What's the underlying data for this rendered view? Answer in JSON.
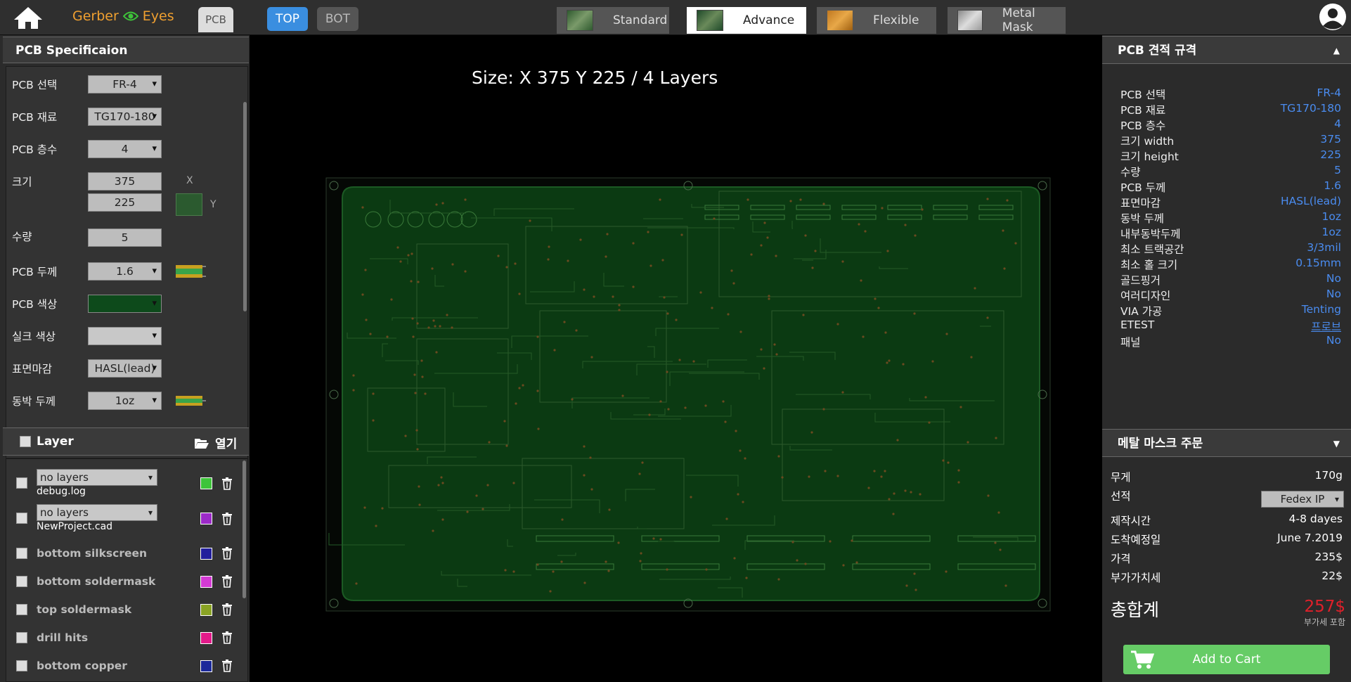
{
  "topbar": {
    "brand_left": "Gerber",
    "brand_right": "Eyes",
    "pcb_tab": "PCB",
    "side_tabs": {
      "top": "TOP",
      "bot": "BOT"
    },
    "product_tabs": [
      {
        "label": "Standard",
        "active": false
      },
      {
        "label": "Advance",
        "active": true
      },
      {
        "label": "Flexible",
        "active": false
      },
      {
        "label": "Metal Mask",
        "active": false
      }
    ]
  },
  "spec_panel": {
    "title": "PCB Specificaion",
    "rows": {
      "pcb_select": {
        "label": "PCB 선택",
        "value": "FR-4"
      },
      "pcb_material": {
        "label": "PCB 재료",
        "value": "TG170-180"
      },
      "pcb_layers": {
        "label": "PCB 층수",
        "value": "4"
      },
      "size": {
        "label": "크기",
        "x": "375",
        "y": "225",
        "x_label": "X",
        "y_label": "Y"
      },
      "quantity": {
        "label": "수량",
        "value": "5"
      },
      "thickness": {
        "label": "PCB 두께",
        "value": "1.6"
      },
      "pcb_color": {
        "label": "PCB 색상",
        "value_color": "#0d4a1b"
      },
      "silk_color": {
        "label": "실크 색상"
      },
      "surface": {
        "label": "표면마감",
        "value": "HASL(lead)"
      },
      "copper": {
        "label": "동박 두께",
        "value": "1oz"
      }
    }
  },
  "layer_panel": {
    "title": "Layer",
    "open_label": "열기",
    "layers": [
      {
        "select": "no layers",
        "name": "debug.log",
        "color": "#3ec43a"
      },
      {
        "select": "no layers",
        "name": "NewProject.cad",
        "color": "#9c2ac8"
      },
      {
        "name": "bottom silkscreen",
        "color": "#221e9c"
      },
      {
        "name": "bottom soldermask",
        "color": "#d43ad4"
      },
      {
        "name": "top soldermask",
        "color": "#8aa324"
      },
      {
        "name": "drill hits",
        "color": "#e21a8a"
      },
      {
        "name": "bottom copper",
        "color": "#1c2a9a"
      }
    ]
  },
  "viewer": {
    "size_text": "Size: X 375 Y 225 / 4 Layers",
    "board_color": "#0b3a12"
  },
  "quote_panel": {
    "title": "PCB 견적 규격",
    "rows": [
      {
        "label": "PCB 선택",
        "value": "FR-4"
      },
      {
        "label": "PCB 재료",
        "value": "TG170-180"
      },
      {
        "label": "PCB 층수",
        "value": "4"
      },
      {
        "label": "크기 width",
        "value": "375"
      },
      {
        "label": "크기 height",
        "value": "225"
      },
      {
        "label": "수량",
        "value": "5"
      },
      {
        "label": "PCB 두께",
        "value": "1.6"
      },
      {
        "label": "표면마감",
        "value": "HASL(lead)"
      },
      {
        "label": "동박 두께",
        "value": "1oz"
      },
      {
        "label": "내부동박두께",
        "value": "1oz"
      },
      {
        "label": "최소 트랙공간",
        "value": "3/3mil"
      },
      {
        "label": "최소 홀 크기",
        "value": "0.15mm"
      },
      {
        "label": "골드핑거",
        "value": "No"
      },
      {
        "label": "여러디자인",
        "value": "No"
      },
      {
        "label": "VIA 가공",
        "value": "Tenting"
      },
      {
        "label": "ETEST",
        "value": "프로브"
      },
      {
        "label": "패널",
        "value": "No"
      }
    ]
  },
  "order_panel": {
    "title": "메탈 마스크 주문",
    "weight": {
      "label": "무게",
      "value": "170g"
    },
    "shipping": {
      "label": "선적",
      "value": "Fedex IP"
    },
    "lead_time": {
      "label": "제작시간",
      "value": "4-8 dayes"
    },
    "arrival": {
      "label": "도착예정일",
      "value": "June 7.2019"
    },
    "price": {
      "label": "가격",
      "value": "235$"
    },
    "vat": {
      "label": "부가가치세",
      "value": "22$"
    },
    "total": {
      "label": "총합계",
      "value": "257$",
      "note": "부가세 포함"
    },
    "cart_label": "Add to Cart"
  }
}
